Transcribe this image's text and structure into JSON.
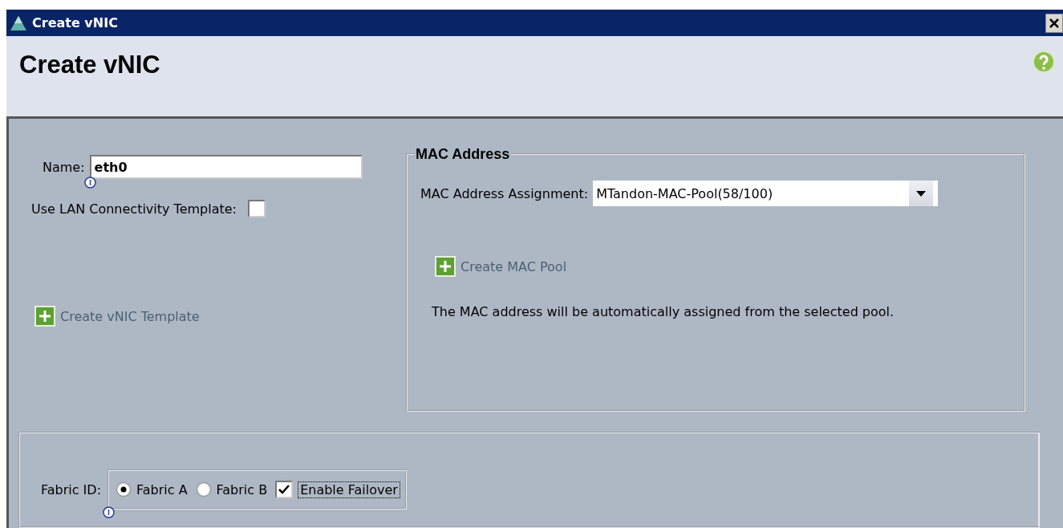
{
  "window": {
    "title": "Create vNIC"
  },
  "header": {
    "title": "Create vNIC"
  },
  "name_field": {
    "label": "Name:",
    "value": "eth0"
  },
  "lan_template": {
    "label": "Use LAN Connectivity Template:",
    "checked": false
  },
  "create_template_link": "Create vNIC Template",
  "mac_address": {
    "title": "MAC Address",
    "assignment_label": "MAC Address Assignment:",
    "assignment_value": "MTandon-MAC-Pool(58/100)",
    "create_pool_link": "Create MAC Pool",
    "note": "The MAC address will be automatically assigned from the selected pool."
  },
  "fabric": {
    "label": "Fabric ID:",
    "options": [
      {
        "label": "Fabric A",
        "selected": true
      },
      {
        "label": "Fabric B",
        "selected": false
      }
    ],
    "failover": {
      "label": "Enable Failover",
      "checked": true
    }
  }
}
